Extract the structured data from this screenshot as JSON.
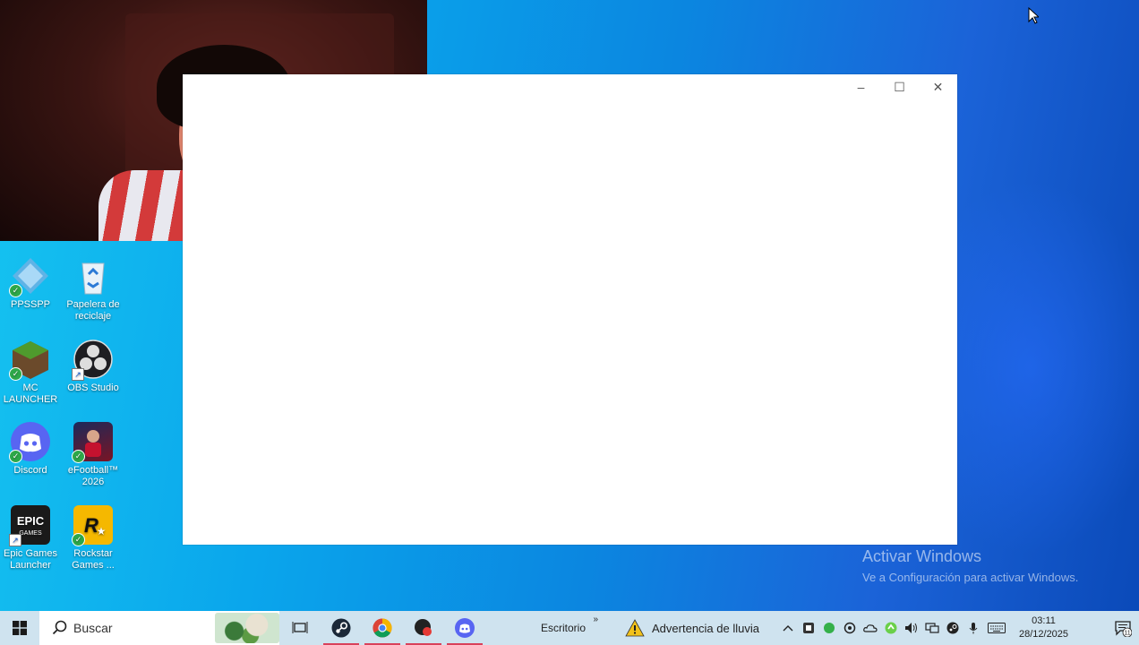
{
  "window": {
    "minimize": "–",
    "maximize": "☐",
    "close": "✕"
  },
  "desktop_icons": [
    {
      "label": "PPSSPP",
      "icon": "ppsspp-icon"
    },
    {
      "label": "Papelera de reciclaje",
      "icon": "recycle-bin-icon"
    },
    {
      "label": "MC LAUNCHER",
      "icon": "minecraft-icon"
    },
    {
      "label": "OBS Studio",
      "icon": "obs-icon"
    },
    {
      "label": "Discord",
      "icon": "discord-icon"
    },
    {
      "label": "eFootball™ 2026",
      "icon": "efootball-icon"
    },
    {
      "label": "Epic Games Launcher",
      "icon": "epic-games-icon"
    },
    {
      "label": "Rockstar Games ...",
      "icon": "rockstar-icon"
    }
  ],
  "watermark": {
    "title": "Activar Windows",
    "subtitle": "Ve a Configuración para activar Windows."
  },
  "taskbar": {
    "search_placeholder": "Buscar",
    "desktop_label": "Escritorio",
    "desktop_chevron": "»",
    "weather_label": "Advertencia de lluvia",
    "time": "03:11",
    "date": "28/12/2025",
    "notification_count": "11",
    "apps": [
      "task-view-icon",
      "steam-icon",
      "chrome-icon",
      "app-red-icon",
      "discord-icon"
    ]
  },
  "colors": {
    "taskbar": "#cfe3ef",
    "window": "#ffffff",
    "open_indicator": "#d9415a"
  }
}
